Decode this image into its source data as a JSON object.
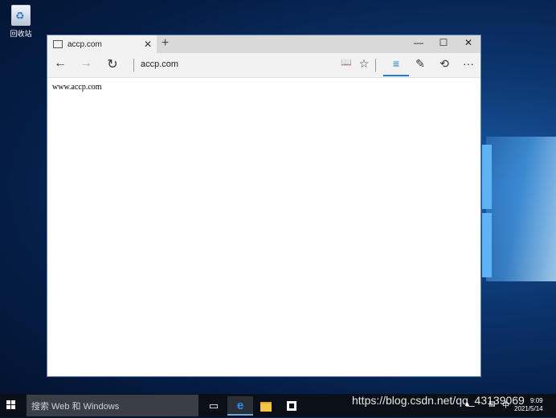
{
  "desktop": {
    "recycle_bin_label": "回收站"
  },
  "browser": {
    "tab_title": "accp.com",
    "tab_close": "✕",
    "new_tab": "+",
    "window_controls": {
      "minimize": "—",
      "maximize": "☐",
      "close": "✕"
    },
    "nav": {
      "back": "←",
      "forward": "→",
      "refresh": "↻"
    },
    "address": "accp.com",
    "tools": {
      "reading_view": "📖",
      "favorite": "☆",
      "hub": "≡",
      "notes": "✎",
      "share": "⟲",
      "more": "···"
    },
    "page_text": "www.accp.com"
  },
  "taskbar": {
    "search_placeholder": "搜索 Web 和 Windows",
    "task_view_icon": "▭",
    "edge_icon": "e",
    "clock_time": "9:09",
    "clock_date": "2021/5/14"
  },
  "watermark": "https://blog.csdn.net/qq_43139069",
  "colors": {
    "accent": "#1e7bd8",
    "taskbar": "#0b0f18",
    "titlebar": "#d9d9d9"
  }
}
